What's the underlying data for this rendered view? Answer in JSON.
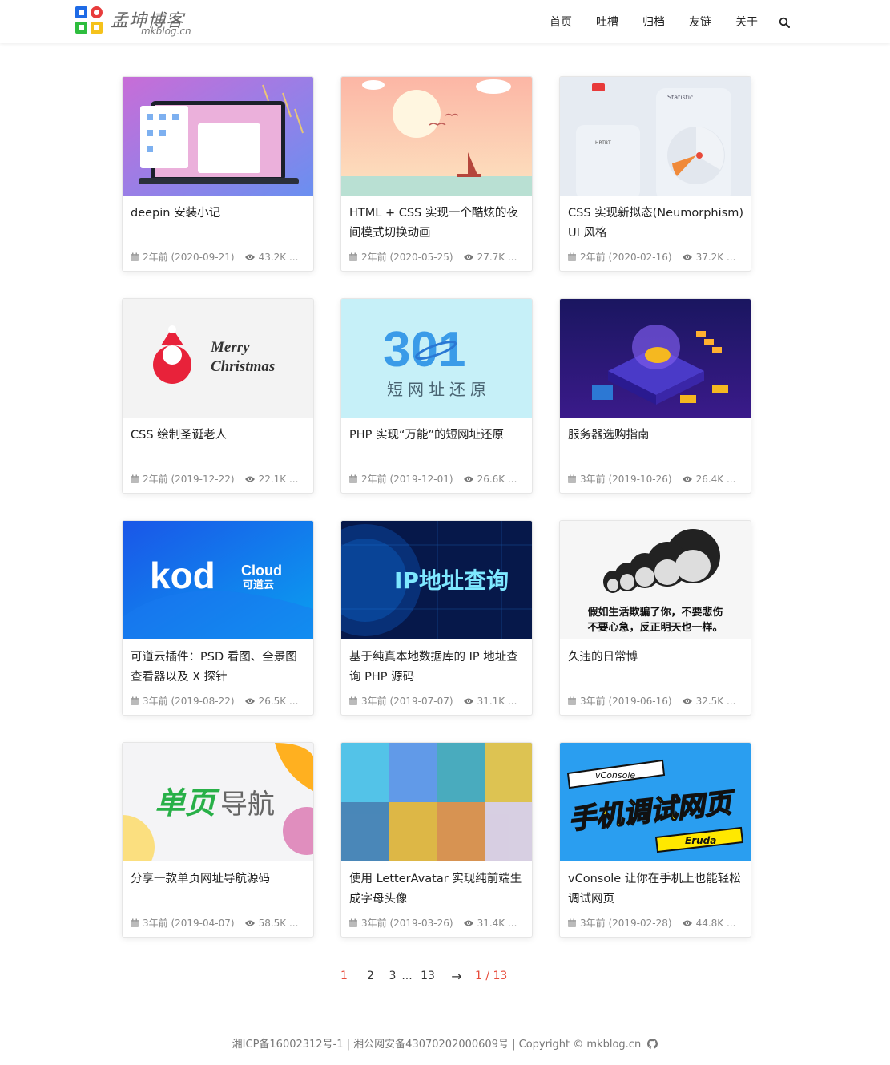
{
  "site": {
    "title": "孟坤博客",
    "subtitle": "mkblog.cn"
  },
  "nav": {
    "items": [
      "首页",
      "吐槽",
      "归档",
      "友链",
      "关于"
    ]
  },
  "colors": {
    "accent": "#e74c3c",
    "logo_blue": "#1e6be6",
    "logo_red": "#e83c3c",
    "logo_green": "#2ebd3e",
    "logo_yellow": "#f5c21b"
  },
  "posts": [
    {
      "title": "deepin 安装小记",
      "date": "2年前 (2020-09-21)",
      "views": "43.2K ...",
      "thumb": "deepin-laptop"
    },
    {
      "title": "HTML + CSS 实现一个酷炫的夜间模式切换动画",
      "date": "2年前 (2020-05-25)",
      "views": "27.7K ...",
      "thumb": "sunset-boat"
    },
    {
      "title": "CSS 实现新拟态(Neumorphism) UI 风格",
      "date": "2年前 (2020-02-16)",
      "views": "37.2K ...",
      "thumb": "neumorphism",
      "thumb_text": "Statistic"
    },
    {
      "title": "CSS 绘制圣诞老人",
      "date": "2年前 (2019-12-22)",
      "views": "22.1K ...",
      "thumb": "santa",
      "thumb_text": [
        "Merry",
        "Christmas"
      ]
    },
    {
      "title": "PHP 实现“万能”的短网址还原",
      "date": "2年前 (2019-12-01)",
      "views": "26.6K ...",
      "thumb": "301",
      "thumb_text": [
        "301",
        "短网址还原"
      ]
    },
    {
      "title": "服务器选购指南",
      "date": "3年前 (2019-10-26)",
      "views": "26.4K ...",
      "thumb": "server-iso"
    },
    {
      "title": "可道云插件：PSD 看图、全景图查看器以及 X 探针",
      "date": "3年前 (2019-08-22)",
      "views": "26.5K ...",
      "thumb": "kodcloud",
      "thumb_text": [
        "kod",
        "Cloud",
        "可道云"
      ]
    },
    {
      "title": "基于纯真本地数据库的 IP 地址查询 PHP 源码",
      "date": "3年前 (2019-07-07)",
      "views": "31.1K ...",
      "thumb": "ip-query",
      "thumb_text": "IP地址查询"
    },
    {
      "title": "久违的日常博",
      "date": "3年前 (2019-06-16)",
      "views": "32.5K ...",
      "thumb": "meme",
      "thumb_text": [
        "假如生活欺骗了你，不要悲伤",
        "不要心急，反正明天也一样。"
      ]
    },
    {
      "title": "分享一款单页网址导航源码",
      "date": "3年前 (2019-04-07)",
      "views": "58.5K ...",
      "thumb": "single-nav",
      "thumb_text": [
        "单页",
        "导航"
      ]
    },
    {
      "title": "使用 LetterAvatar 实现纯前端生成字母头像",
      "date": "3年前 (2019-03-26)",
      "views": "31.4K ...",
      "thumb": "letter-avatar"
    },
    {
      "title": "vConsole 让你在手机上也能轻松调试网页",
      "date": "3年前 (2019-02-28)",
      "views": "44.8K ...",
      "thumb": "vconsole",
      "thumb_text": [
        "vConsole",
        "手机调试网页",
        "Eruda"
      ]
    }
  ],
  "pagination": {
    "current": "1",
    "pages": [
      "2",
      "3"
    ],
    "ellipsis": "...",
    "last": "13",
    "next": "→",
    "total": "1 / 13"
  },
  "footer": {
    "text": "湘ICP备16002312号-1 | 湘公网安备43070202000609号 | Copyright © mkblog.cn"
  }
}
